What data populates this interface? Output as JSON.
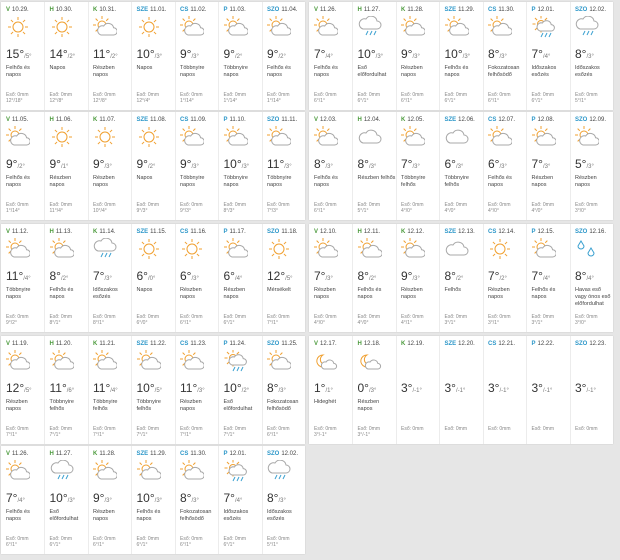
{
  "weeks": [
    [
      {
        "dn": "V",
        "dnc": "dn-v",
        "date": "10.29.",
        "icon": "sun",
        "hi": "15°",
        "lo": "/5°",
        "desc": "Felhős és napos",
        "e1": "Eső: 0mm",
        "e2": "12°/18°"
      },
      {
        "dn": "H",
        "dnc": "dn-h",
        "date": "10.30.",
        "icon": "sun",
        "hi": "14°",
        "lo": "/2°",
        "desc": "Napos",
        "e1": "Eső: 0mm",
        "e2": "12°/8°"
      },
      {
        "dn": "K",
        "dnc": "dn-k",
        "date": "10.31.",
        "icon": "partly",
        "hi": "11°",
        "lo": "/2°",
        "desc": "Részben napos",
        "e1": "Eső: 0mm",
        "e2": "12°/8°"
      },
      {
        "dn": "SZE",
        "dnc": "dn-sze",
        "date": "11.01.",
        "icon": "sun",
        "hi": "10°",
        "lo": "/3°",
        "desc": "Napos",
        "e1": "Eső: 0mm",
        "e2": "12°/4°"
      },
      {
        "dn": "CS",
        "dnc": "dn-cs",
        "date": "11.02.",
        "icon": "partly",
        "hi": "9°",
        "lo": "/3°",
        "desc": "Többnyire napos",
        "e1": "Eső: 0mm",
        "e2": "1°/14°"
      },
      {
        "dn": "P",
        "dnc": "dn-p",
        "date": "11.03.",
        "icon": "partly",
        "hi": "9°",
        "lo": "/2°",
        "desc": "Többnyire napos",
        "e1": "Eső: 0mm",
        "e2": "1°/14°"
      },
      {
        "dn": "SZO",
        "dnc": "dn-szo",
        "date": "11.04.",
        "icon": "partly",
        "hi": "9°",
        "lo": "/2°",
        "desc": "Felhős és napos",
        "e1": "Eső: 0mm",
        "e2": "1°/14°"
      }
    ],
    [
      {
        "dn": "V",
        "dnc": "dn-v",
        "date": "11.26.",
        "icon": "partly",
        "hi": "7°",
        "lo": "/4°",
        "desc": "Felhős és napos",
        "e1": "Eső: 0mm",
        "e2": "6°/1°"
      },
      {
        "dn": "H",
        "dnc": "dn-h",
        "date": "11.27.",
        "icon": "rain",
        "hi": "10°",
        "lo": "/3°",
        "desc": "Eső előfordulhat",
        "e1": "Eső: 0mm",
        "e2": "6°/1°"
      },
      {
        "dn": "K",
        "dnc": "dn-k",
        "date": "11.28.",
        "icon": "partly",
        "hi": "9°",
        "lo": "/3°",
        "desc": "Részben napos",
        "e1": "Eső: 0mm",
        "e2": "6°/1°"
      },
      {
        "dn": "SZE",
        "dnc": "dn-sze",
        "date": "11.29.",
        "icon": "partly",
        "hi": "10°",
        "lo": "/3°",
        "desc": "Felhős és napos",
        "e1": "Eső: 0mm",
        "e2": "6°/1°"
      },
      {
        "dn": "CS",
        "dnc": "dn-cs",
        "date": "11.30.",
        "icon": "partly",
        "hi": "8°",
        "lo": "/3°",
        "desc": "Fokozatosan felhősödő",
        "e1": "Eső: 0mm",
        "e2": "6°/1°"
      },
      {
        "dn": "P",
        "dnc": "dn-p",
        "date": "12.01.",
        "icon": "rainsun",
        "hi": "7°",
        "lo": "/4°",
        "desc": "Időszakos esőzés",
        "e1": "Eső: 0mm",
        "e2": "6°/1°"
      },
      {
        "dn": "SZO",
        "dnc": "dn-szo",
        "date": "12.02.",
        "icon": "rain",
        "hi": "8°",
        "lo": "/3°",
        "desc": "Időszakos esőzés",
        "e1": "Eső: 0mm",
        "e2": "5°/1°"
      }
    ],
    [
      {
        "dn": "V",
        "dnc": "dn-v",
        "date": "11.05.",
        "icon": "partly",
        "hi": "9°",
        "lo": "/2°",
        "desc": "Felhős és napos",
        "e1": "Eső: 0mm",
        "e2": "1°/14°"
      },
      {
        "dn": "H",
        "dnc": "dn-h",
        "date": "11.06.",
        "icon": "sun",
        "hi": "9°",
        "lo": "/1°",
        "desc": "Részben napos",
        "e1": "Eső: 0mm",
        "e2": "11°/4°"
      },
      {
        "dn": "K",
        "dnc": "dn-k",
        "date": "11.07.",
        "icon": "sun",
        "hi": "9°",
        "lo": "/3°",
        "desc": "Részben napos",
        "e1": "Eső: 0mm",
        "e2": "10°/4°"
      },
      {
        "dn": "SZE",
        "dnc": "dn-sze",
        "date": "11.08.",
        "icon": "sun",
        "hi": "9°",
        "lo": "/2°",
        "desc": "Napos",
        "e1": "Eső: 0mm",
        "e2": "9°/3°"
      },
      {
        "dn": "CS",
        "dnc": "dn-cs",
        "date": "11.09.",
        "icon": "partly",
        "hi": "9°",
        "lo": "/3°",
        "desc": "Többnyire napos",
        "e1": "Eső: 0mm",
        "e2": "9°/3°"
      },
      {
        "dn": "P",
        "dnc": "dn-p",
        "date": "11.10.",
        "icon": "partly",
        "hi": "10°",
        "lo": "/3°",
        "desc": "Többnyire napos",
        "e1": "Eső: 0mm",
        "e2": "8°/3°"
      },
      {
        "dn": "SZO",
        "dnc": "dn-szo",
        "date": "11.11.",
        "icon": "partly",
        "hi": "11°",
        "lo": "/3°",
        "desc": "Többnyire napos",
        "e1": "Eső: 0mm",
        "e2": "7°/3°"
      }
    ],
    [
      {
        "dn": "V",
        "dnc": "dn-v",
        "date": "12.03.",
        "icon": "partly",
        "hi": "8°",
        "lo": "/3°",
        "desc": "Felhős és napos",
        "e1": "Eső: 0mm",
        "e2": "6°/1°"
      },
      {
        "dn": "H",
        "dnc": "dn-h",
        "date": "12.04.",
        "icon": "cloud",
        "hi": "8°",
        "lo": "/3°",
        "desc": "Részben felhős",
        "e1": "Eső: 0mm",
        "e2": "5°/1°"
      },
      {
        "dn": "K",
        "dnc": "dn-k",
        "date": "12.05.",
        "icon": "partly",
        "hi": "7°",
        "lo": "/3°",
        "desc": "Többnyire felhős",
        "e1": "Eső: 0mm",
        "e2": "4°/0°"
      },
      {
        "dn": "SZE",
        "dnc": "dn-sze",
        "date": "12.06.",
        "icon": "cloud",
        "hi": "6°",
        "lo": "/3°",
        "desc": "Többnyire felhős",
        "e1": "Eső: 0mm",
        "e2": "4°/0°"
      },
      {
        "dn": "CS",
        "dnc": "dn-cs",
        "date": "12.07.",
        "icon": "partly",
        "hi": "6°",
        "lo": "/3°",
        "desc": "Felhős és napos",
        "e1": "Eső: 0mm",
        "e2": "4°/0°"
      },
      {
        "dn": "P",
        "dnc": "dn-p",
        "date": "12.08.",
        "icon": "partly",
        "hi": "7°",
        "lo": "/3°",
        "desc": "Részben napos",
        "e1": "Eső: 0mm",
        "e2": "4°/0°"
      },
      {
        "dn": "SZO",
        "dnc": "dn-szo",
        "date": "12.09.",
        "icon": "partly",
        "hi": "5°",
        "lo": "/3°",
        "desc": "Részben napos",
        "e1": "Eső: 0mm",
        "e2": "3°/0°"
      }
    ],
    [
      {
        "dn": "V",
        "dnc": "dn-v",
        "date": "11.12.",
        "icon": "partly",
        "hi": "11°",
        "lo": "/4°",
        "desc": "Többnyire napos",
        "e1": "Eső: 0mm",
        "e2": "9°/2°"
      },
      {
        "dn": "H",
        "dnc": "dn-h",
        "date": "11.13.",
        "icon": "partly",
        "hi": "8°",
        "lo": "/2°",
        "desc": "Felhős és napos",
        "e1": "Eső: 0mm",
        "e2": "8°/1°"
      },
      {
        "dn": "K",
        "dnc": "dn-k",
        "date": "11.14.",
        "icon": "rain",
        "hi": "7°",
        "lo": "/3°",
        "desc": "Időszakos esőzés",
        "e1": "Eső: 0mm",
        "e2": "8°/1°"
      },
      {
        "dn": "SZE",
        "dnc": "dn-sze",
        "date": "11.15.",
        "icon": "sun",
        "hi": "6°",
        "lo": "/0°",
        "desc": "Napos",
        "e1": "Eső: 0mm",
        "e2": "6°/0°"
      },
      {
        "dn": "CS",
        "dnc": "dn-cs",
        "date": "11.16.",
        "icon": "sun",
        "hi": "6°",
        "lo": "/3°",
        "desc": "Részben napos",
        "e1": "Eső: 0mm",
        "e2": "6°/1°"
      },
      {
        "dn": "P",
        "dnc": "dn-p",
        "date": "11.17.",
        "icon": "partly",
        "hi": "6°",
        "lo": "/4°",
        "desc": "Részben napos",
        "e1": "Eső: 0mm",
        "e2": "6°/1°"
      },
      {
        "dn": "SZO",
        "dnc": "dn-szo",
        "date": "11.18.",
        "icon": "sun",
        "hi": "12°",
        "lo": "/5°",
        "desc": "Mérsékelt",
        "e1": "Eső: 0mm",
        "e2": "7°/1°"
      }
    ],
    [
      {
        "dn": "V",
        "dnc": "dn-v",
        "date": "12.10.",
        "icon": "partly",
        "hi": "7°",
        "lo": "/3°",
        "desc": "Részben napos",
        "e1": "Eső: 0mm",
        "e2": "4°/0°"
      },
      {
        "dn": "H",
        "dnc": "dn-h",
        "date": "12.11.",
        "icon": "partly",
        "hi": "8°",
        "lo": "/2°",
        "desc": "Felhős és napos",
        "e1": "Eső: 0mm",
        "e2": "4°/0°"
      },
      {
        "dn": "K",
        "dnc": "dn-k",
        "date": "12.12.",
        "icon": "partly",
        "hi": "9°",
        "lo": "/3°",
        "desc": "Részben napos",
        "e1": "Eső: 0mm",
        "e2": "4°/1°"
      },
      {
        "dn": "SZE",
        "dnc": "dn-sze",
        "date": "12.13.",
        "icon": "cloud",
        "hi": "8°",
        "lo": "/2°",
        "desc": "Felhős",
        "e1": "Eső: 0mm",
        "e2": "3°/1°"
      },
      {
        "dn": "CS",
        "dnc": "dn-cs",
        "date": "12.14.",
        "icon": "sun",
        "hi": "7°",
        "lo": "/2°",
        "desc": "Részben napos",
        "e1": "Eső: 0mm",
        "e2": "3°/1°"
      },
      {
        "dn": "P",
        "dnc": "dn-p",
        "date": "12.15.",
        "icon": "partly",
        "hi": "7°",
        "lo": "/4°",
        "desc": "Felhős és napos",
        "e1": "Eső: 0mm",
        "e2": "3°/1°"
      },
      {
        "dn": "SZO",
        "dnc": "dn-szo",
        "date": "12.16.",
        "icon": "sleet",
        "hi": "8°",
        "lo": "/4°",
        "desc": "Havas eső vagy ónos eső előfordulhat",
        "e1": "Eső: 0mm",
        "e2": "3°/0°"
      }
    ],
    [
      {
        "dn": "V",
        "dnc": "dn-v",
        "date": "11.19.",
        "icon": "partly",
        "hi": "12°",
        "lo": "/5°",
        "desc": "Részben napos",
        "e1": "Eső: 0mm",
        "e2": "7°/1°"
      },
      {
        "dn": "H",
        "dnc": "dn-h",
        "date": "11.20.",
        "icon": "partly",
        "hi": "11°",
        "lo": "/6°",
        "desc": "Többnyire felhős",
        "e1": "Eső: 0mm",
        "e2": "7°/1°"
      },
      {
        "dn": "K",
        "dnc": "dn-k",
        "date": "11.21.",
        "icon": "partly",
        "hi": "11°",
        "lo": "/4°",
        "desc": "Többnyire felhős",
        "e1": "Eső: 0mm",
        "e2": "7°/1°"
      },
      {
        "dn": "SZE",
        "dnc": "dn-sze",
        "date": "11.22.",
        "icon": "partly",
        "hi": "10°",
        "lo": "/5°",
        "desc": "Többnyire felhős",
        "e1": "Eső: 0mm",
        "e2": "7°/1°"
      },
      {
        "dn": "CS",
        "dnc": "dn-cs",
        "date": "11.23.",
        "icon": "partly",
        "hi": "11°",
        "lo": "/3°",
        "desc": "Részben napos",
        "e1": "Eső: 0mm",
        "e2": "7°/1°"
      },
      {
        "dn": "P",
        "dnc": "dn-p",
        "date": "11.24.",
        "icon": "rainsun",
        "hi": "10°",
        "lo": "/2°",
        "desc": "Eső előfordulhat",
        "e1": "Eső: 0mm",
        "e2": "7°/1°"
      },
      {
        "dn": "SZO",
        "dnc": "dn-szo",
        "date": "11.25.",
        "icon": "partly",
        "hi": "8°",
        "lo": "/3°",
        "desc": "Fokozatosan felhősödő",
        "e1": "Eső: 0mm",
        "e2": "6°/1°"
      }
    ],
    [
      {
        "dn": "V",
        "dnc": "dn-v",
        "date": "12.17.",
        "icon": "moon",
        "hi": "1°",
        "lo": "/1°",
        "desc": "Hideghét",
        "e1": "Eső: 0mm",
        "e2": "3°/-1°"
      },
      {
        "dn": "H",
        "dnc": "dn-h",
        "date": "12.18.",
        "icon": "moon",
        "hi": "0°",
        "lo": "/3°",
        "desc": "Részben napos",
        "e1": "Eső: 0mm",
        "e2": "3°/-1°"
      },
      {
        "dn": "K",
        "dnc": "dn-k",
        "date": "12.19.",
        "icon": "none",
        "hi": "3°",
        "lo": "/-1°",
        "desc": "",
        "e1": "Eső: 0mm",
        "e2": ""
      },
      {
        "dn": "SZE",
        "dnc": "dn-sze",
        "date": "12.20.",
        "icon": "none",
        "hi": "3°",
        "lo": "/-1°",
        "desc": "",
        "e1": "Eső: 0mm",
        "e2": ""
      },
      {
        "dn": "CS",
        "dnc": "dn-cs",
        "date": "12.21.",
        "icon": "none",
        "hi": "3°",
        "lo": "/-1°",
        "desc": "",
        "e1": "Eső: 0mm",
        "e2": ""
      },
      {
        "dn": "P",
        "dnc": "dn-p",
        "date": "12.22.",
        "icon": "none",
        "hi": "3°",
        "lo": "/-1°",
        "desc": "",
        "e1": "Eső: 0mm",
        "e2": ""
      },
      {
        "dn": "SZO",
        "dnc": "dn-szo",
        "date": "12.23.",
        "icon": "none",
        "hi": "3°",
        "lo": "/-1°",
        "desc": "",
        "e1": "Eső: 0mm",
        "e2": ""
      }
    ],
    [
      {
        "dn": "V",
        "dnc": "dn-v",
        "date": "11.26.",
        "icon": "partly",
        "hi": "7°",
        "lo": "/4°",
        "desc": "Felhős és napos",
        "e1": "Eső: 0mm",
        "e2": "6°/1°"
      },
      {
        "dn": "H",
        "dnc": "dn-h",
        "date": "11.27.",
        "icon": "rain",
        "hi": "10°",
        "lo": "/3°",
        "desc": "Eső előfordulhat",
        "e1": "Eső: 0mm",
        "e2": "6°/1°"
      },
      {
        "dn": "K",
        "dnc": "dn-k",
        "date": "11.28.",
        "icon": "partly",
        "hi": "9°",
        "lo": "/3°",
        "desc": "Részben napos",
        "e1": "Eső: 0mm",
        "e2": "6°/1°"
      },
      {
        "dn": "SZE",
        "dnc": "dn-sze",
        "date": "11.29.",
        "icon": "partly",
        "hi": "10°",
        "lo": "/3°",
        "desc": "Felhős és napos",
        "e1": "Eső: 0mm",
        "e2": "6°/1°"
      },
      {
        "dn": "CS",
        "dnc": "dn-cs",
        "date": "11.30.",
        "icon": "partly",
        "hi": "8°",
        "lo": "/3°",
        "desc": "Fokozatosan felhősödő",
        "e1": "Eső: 0mm",
        "e2": "6°/1°"
      },
      {
        "dn": "P",
        "dnc": "dn-p",
        "date": "12.01.",
        "icon": "rainsun",
        "hi": "7°",
        "lo": "/4°",
        "desc": "Időszakos esőzés",
        "e1": "Eső: 0mm",
        "e2": "6°/1°"
      },
      {
        "dn": "SZO",
        "dnc": "dn-szo",
        "date": "12.02.",
        "icon": "rain",
        "hi": "8°",
        "lo": "/3°",
        "desc": "Időszakos esőzés",
        "e1": "Eső: 0mm",
        "e2": "5°/1°"
      }
    ]
  ],
  "colors": {
    "sun": "#f0a030",
    "cloud": "#a8a8a8",
    "rain": "#3aa0d0",
    "snow": "#3aa0d0"
  }
}
